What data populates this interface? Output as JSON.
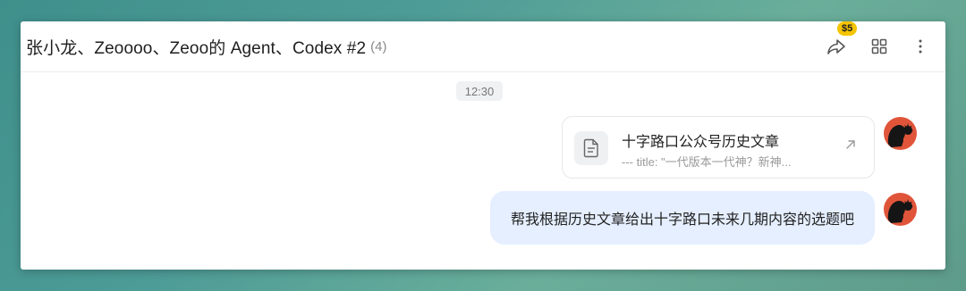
{
  "header": {
    "title": "张小龙、Zeoooo、Zeoo的 Agent、Codex #2",
    "member_count": "(4)",
    "badge": "$5",
    "icons": [
      "share-arrow-icon",
      "grid-icon",
      "more-vertical-icon"
    ]
  },
  "timestamp": "12:30",
  "messages": [
    {
      "type": "file-card",
      "title": "十字路口公众号历史文章",
      "preview": "--- title: \"一代版本一代神？新神...",
      "icon": "document-icon"
    },
    {
      "type": "text",
      "text": "帮我根据历史文章给出十字路口未来几期内容的选题吧"
    }
  ],
  "colors": {
    "bubble_bg": "#e5efff",
    "badge_bg": "#f5c400",
    "avatar_bg": "#e0553a"
  }
}
